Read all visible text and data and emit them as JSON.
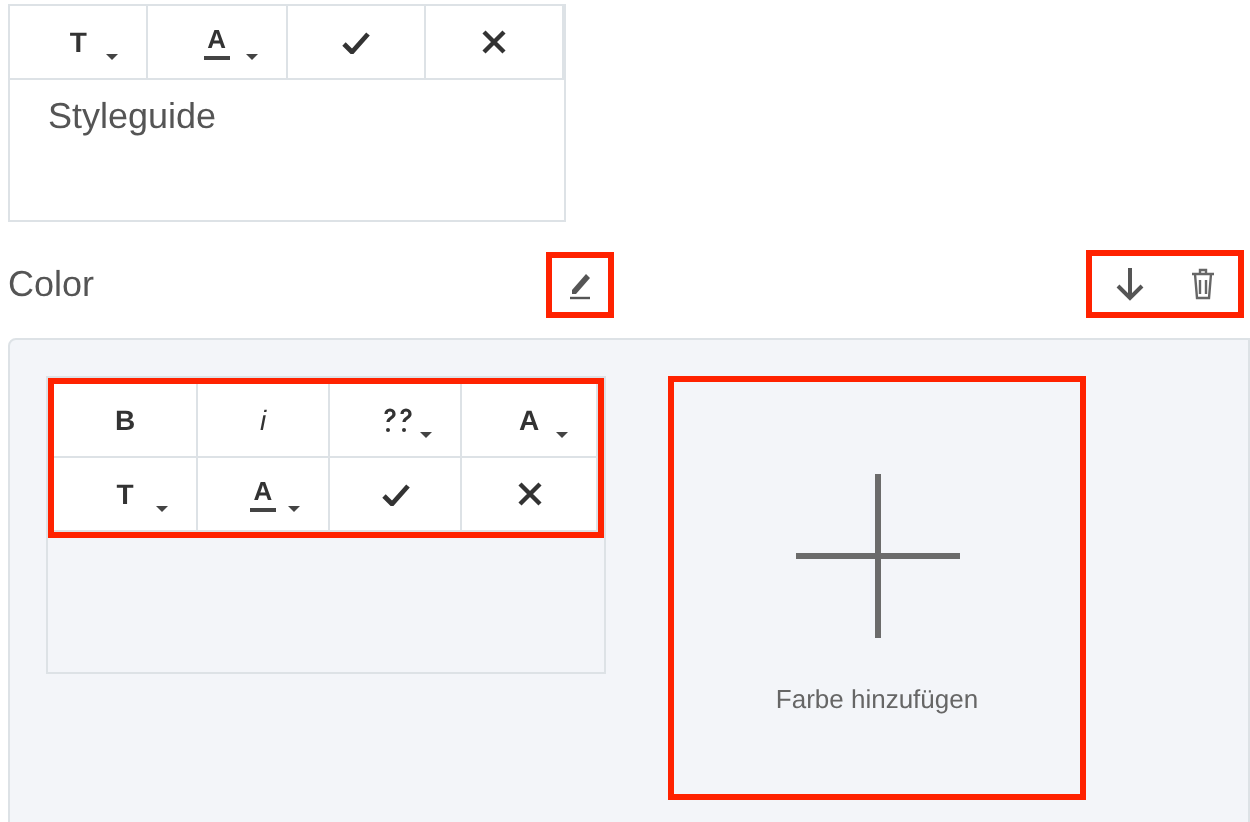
{
  "top_editor": {
    "toolbar": [
      {
        "kind": "text",
        "label": "T",
        "caret": true
      },
      {
        "kind": "color",
        "label": "A",
        "caret": true
      },
      {
        "kind": "check",
        "caret": false
      },
      {
        "kind": "close",
        "caret": false
      }
    ],
    "text": "Styleguide"
  },
  "section": {
    "title": "Color",
    "edit_highlighted": true,
    "actions_highlighted": true
  },
  "color_editor": {
    "highlighted": true,
    "toolbar": [
      {
        "kind": "bold",
        "label": "B",
        "caret": false
      },
      {
        "kind": "italic",
        "label": "i",
        "caret": false
      },
      {
        "kind": "link",
        "caret": true
      },
      {
        "kind": "text",
        "label": "A",
        "caret": true
      },
      {
        "kind": "text",
        "label": "T",
        "caret": true
      },
      {
        "kind": "color",
        "label": "A",
        "caret": true
      },
      {
        "kind": "check",
        "caret": false
      },
      {
        "kind": "close",
        "caret": false
      }
    ]
  },
  "add_color": {
    "label": "Farbe hinzufügen",
    "highlighted": true
  }
}
